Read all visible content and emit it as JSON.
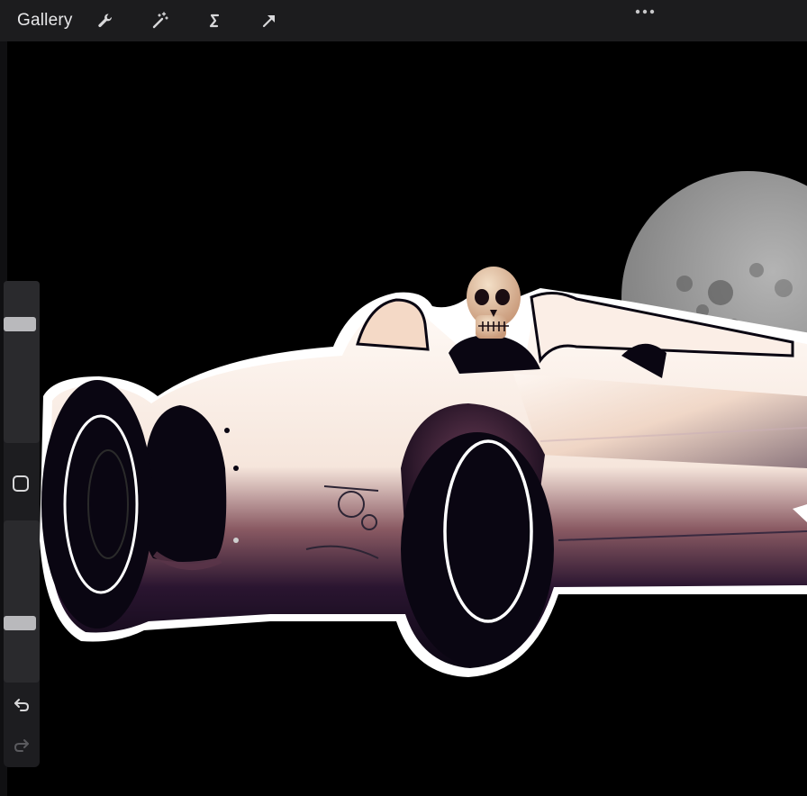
{
  "toolbar": {
    "gallery_label": "Gallery",
    "tools": [
      {
        "icon": "wrench-icon",
        "name": "actions"
      },
      {
        "icon": "magic-wand-icon",
        "name": "adjustments"
      },
      {
        "icon": "selection-s-icon",
        "name": "selection"
      },
      {
        "icon": "arrow-cursor-icon",
        "name": "transform"
      }
    ],
    "more_icon": "ellipsis-icon"
  },
  "sidebar": {
    "brush_size_level": 0.25,
    "opacity_level": 0.65,
    "modify_icon": "square-icon",
    "undo_icon": "undo-icon",
    "redo_icon": "redo-icon"
  },
  "colors": {
    "toolbar_bg": "#1c1c1e",
    "canvas_bg": "#000000",
    "car_body": "#fdf8f5",
    "shadow": "#0a0612",
    "accent_purple": "#5a3448",
    "moon": "#9a9a9a"
  }
}
